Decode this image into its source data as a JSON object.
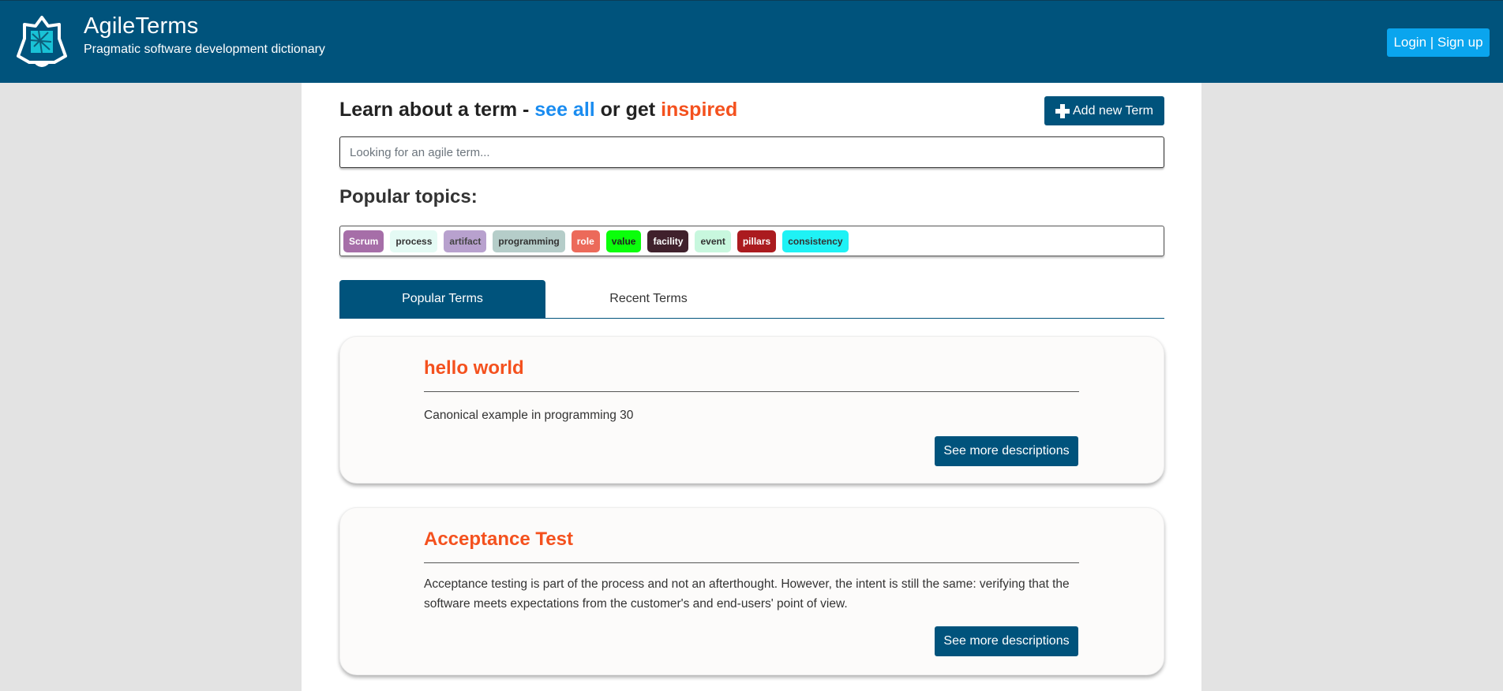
{
  "header": {
    "title": "AgileTerms",
    "subtitle": "Pragmatic software development dictionary",
    "login_label": "Login | Sign up"
  },
  "search_section": {
    "heading_prefix": "Learn about a term - ",
    "see_all": "see all",
    "middle": " or get ",
    "inspired": "inspired",
    "add_label": "Add new Term",
    "placeholder": "Looking for an agile term..."
  },
  "popular_topics": {
    "heading": "Popular topics:",
    "tags": [
      {
        "label": "Scrum",
        "bg": "#a66ea8",
        "fg": "#ffffff"
      },
      {
        "label": "process",
        "bg": "#e4faf4",
        "fg": "#333333"
      },
      {
        "label": "artifact",
        "bg": "#b8a1ce",
        "fg": "#444444"
      },
      {
        "label": "programming",
        "bg": "#b5cdc9",
        "fg": "#333333"
      },
      {
        "label": "role",
        "bg": "#ec6a5a",
        "fg": "#ffffff"
      },
      {
        "label": "value",
        "bg": "#0aff0a",
        "fg": "#222222"
      },
      {
        "label": "facility",
        "bg": "#40212c",
        "fg": "#ffffff"
      },
      {
        "label": "event",
        "bg": "#c8f7de",
        "fg": "#333333"
      },
      {
        "label": "pillars",
        "bg": "#ab1b1f",
        "fg": "#ffffff"
      },
      {
        "label": "consistency",
        "bg": "#1ff2f5",
        "fg": "#333333"
      }
    ]
  },
  "tabs": {
    "popular": "Popular Terms",
    "recent": "Recent Terms"
  },
  "terms": [
    {
      "title": "hello world",
      "description": "Canonical example in programming 30",
      "button": "See more descriptions"
    },
    {
      "title": "Acceptance Test",
      "description": "Acceptance testing is part of the process and not an afterthought. However, the intent is still the same: verifying that the software meets expectations from the customer's and end-users' point of view.",
      "button": "See more descriptions"
    }
  ],
  "colors": {
    "brand": "#00537c",
    "accent": "#f4511e",
    "link": "#1a8cf0",
    "login": "#0aa5ee"
  }
}
